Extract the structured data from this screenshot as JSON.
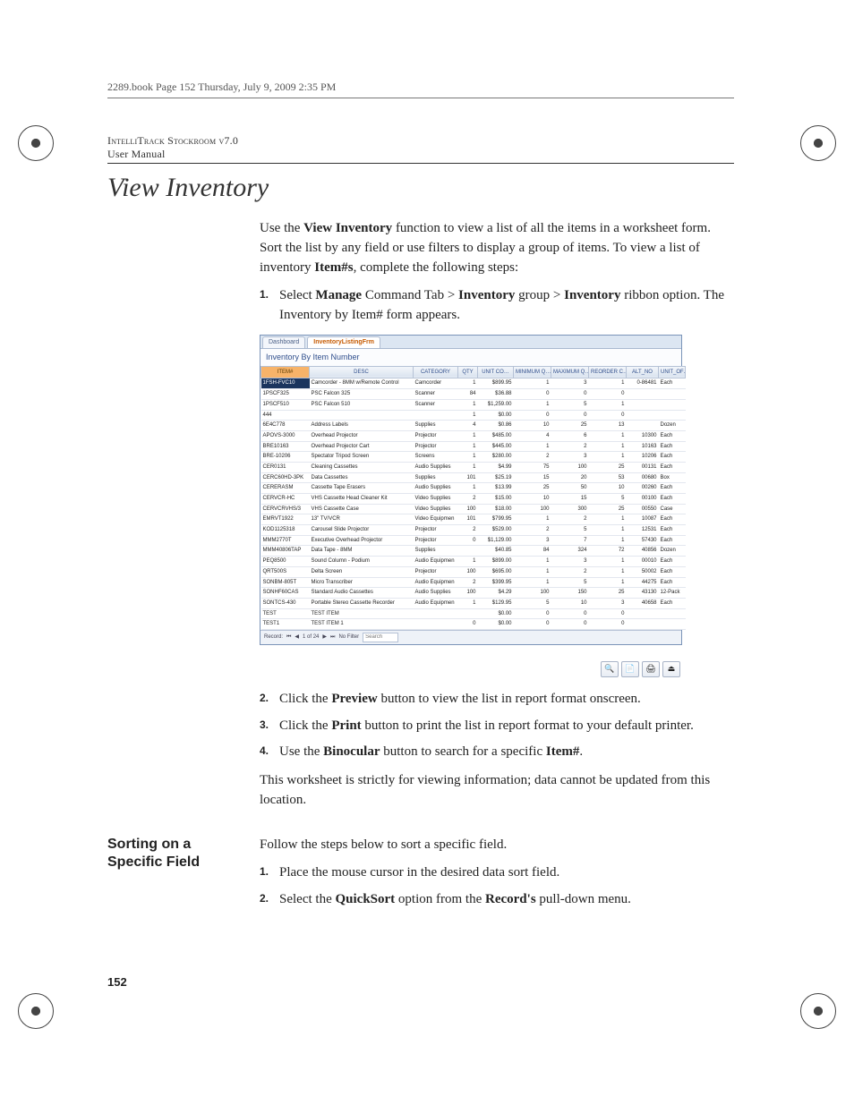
{
  "crop_header": "2289.book  Page 152  Thursday, July 9, 2009  2:35 PM",
  "running_head_line1": "IntelliTrack Stockroom v7.0",
  "running_head_line2": "User Manual",
  "page_title": "View Inventory",
  "intro_pre": "Use the ",
  "intro_b1": "View Inventory",
  "intro_mid": " function to view a list of all the items in a worksheet form. Sort the list by any field or use filters to display a group of items. To view a list of inventory ",
  "intro_b2": "Item#s",
  "intro_post": ", complete the following steps:",
  "step1_pre": "Select ",
  "step1_b1": "Manage",
  "step1_mid1": " Command Tab > ",
  "step1_b2": "Inventory",
  "step1_mid2": " group > ",
  "step1_b3": "Inventory",
  "step1_post": " ribbon option. The Inventory by Item# form appears.",
  "step2_pre": "Click the ",
  "step2_b": "Preview",
  "step2_post": " button to view the list in report format onscreen.",
  "step3_pre": "Click the ",
  "step3_b": "Print",
  "step3_post": " button to print the list in report format to your default printer.",
  "step4_pre": "Use the ",
  "step4_b": "Binocular",
  "step4_mid": " button to search for a specific ",
  "step4_b2": "Item#",
  "step4_post": ".",
  "note_text": "This worksheet is strictly for viewing information; data cannot be updated from this location.",
  "section2_head": "Sorting on a Specific Field",
  "section2_intro": "Follow the steps below to sort a specific field.",
  "s2_step1": "Place the mouse cursor in the desired data sort field.",
  "s2_step2_pre": "Select the ",
  "s2_step2_b1": "QuickSort",
  "s2_step2_mid": " option from the ",
  "s2_step2_b2": "Record's",
  "s2_step2_post": " pull-down menu.",
  "page_number": "152",
  "screenshot": {
    "tab1": "Dashboard",
    "tab2": "InventoryListingFrm",
    "window_title": "Inventory By Item Number",
    "columns": [
      "ITEM#",
      "DESC",
      "CATEGORY",
      "QTY",
      "UNIT CO…",
      "MINIMUM Q…",
      "MAXIMUM Q…",
      "REORDER C…",
      "ALT_NO",
      "UNIT_OF…"
    ],
    "rows": [
      [
        "1FSH-FVC10",
        "Camcorder - 8MM w/Remote Control",
        "Camcorder",
        "1",
        "$899.95",
        "1",
        "3",
        "1",
        "0-86481",
        "Each"
      ],
      [
        "1PSCF325",
        "PSC Falcon 325",
        "Scanner",
        "84",
        "$36.88",
        "0",
        "0",
        "0",
        "",
        ""
      ],
      [
        "1PSCF510",
        "PSC Falcon 510",
        "Scanner",
        "1",
        "$1,259.00",
        "1",
        "5",
        "1",
        "",
        ""
      ],
      [
        "444",
        "",
        "",
        "1",
        "$0.00",
        "0",
        "0",
        "0",
        "",
        ""
      ],
      [
        "6E4C778",
        "Address Labels",
        "Supplies",
        "4",
        "$0.86",
        "10",
        "25",
        "13",
        "",
        "Dozen"
      ],
      [
        "APOVS-3000",
        "Overhead Projector",
        "Projector",
        "1",
        "$485.00",
        "4",
        "6",
        "1",
        "10300",
        "Each"
      ],
      [
        "BRE10163",
        "Overhead Projector Cart",
        "Projector",
        "1",
        "$445.00",
        "1",
        "2",
        "1",
        "10163",
        "Each"
      ],
      [
        "BRE-10206",
        "Spectator Tripod Screen",
        "Screens",
        "1",
        "$280.00",
        "2",
        "3",
        "1",
        "10206",
        "Each"
      ],
      [
        "CER0131",
        "Cleaning Cassettes",
        "Audio Supplies",
        "1",
        "$4.99",
        "75",
        "100",
        "25",
        "00131",
        "Each"
      ],
      [
        "CERC60HD-3PK",
        "Data Cassettes",
        "Supplies",
        "101",
        "$25.19",
        "15",
        "20",
        "53",
        "00680",
        "Box"
      ],
      [
        "CERERASM",
        "Cassette Tape Erasers",
        "Audio Supplies",
        "1",
        "$13.99",
        "25",
        "50",
        "10",
        "00260",
        "Each"
      ],
      [
        "CERVCR-HC",
        "VHS Cassette Head Cleaner Kit",
        "Video Supplies",
        "2",
        "$15.00",
        "10",
        "15",
        "5",
        "00100",
        "Each"
      ],
      [
        "CERVCRVHS/3",
        "VHS Cassette Case",
        "Video Supplies",
        "100",
        "$18.00",
        "100",
        "300",
        "25",
        "00550",
        "Case"
      ],
      [
        "EMRVT1922",
        "13\" TV/VCR",
        "Video Equipmen",
        "101",
        "$799.95",
        "1",
        "2",
        "1",
        "10087",
        "Each"
      ],
      [
        "KOD1125318",
        "Carousel Slide Projector",
        "Projector",
        "2",
        "$529.00",
        "2",
        "5",
        "1",
        "12531",
        "Each"
      ],
      [
        "MMM2770T",
        "Executive Overhead Projector",
        "Projector",
        "0",
        "$1,129.00",
        "3",
        "7",
        "1",
        "57430",
        "Each"
      ],
      [
        "MMM40806TAP",
        "Data Tape - 8MM",
        "Supplies",
        "",
        "$40.85",
        "84",
        "324",
        "72",
        "40856",
        "Dozen"
      ],
      [
        "PEQ8500",
        "Sound Column - Podium",
        "Audio Equipmen",
        "1",
        "$899.00",
        "1",
        "3",
        "1",
        "00010",
        "Each"
      ],
      [
        "QRT500S",
        "Delta Screen",
        "Projector",
        "100",
        "$695.00",
        "1",
        "2",
        "1",
        "50002",
        "Each"
      ],
      [
        "SONBM-805T",
        "Micro Transcriber",
        "Audio Equipmen",
        "2",
        "$399.95",
        "1",
        "5",
        "1",
        "44275",
        "Each"
      ],
      [
        "SONHF60CAS",
        "Standard Audio Cassettes",
        "Audio Supplies",
        "100",
        "$4.29",
        "100",
        "150",
        "25",
        "43130",
        "12-Pack"
      ],
      [
        "SONTCS-430",
        "Portable Stereo Cassette Recorder",
        "Audio Equipmen",
        "1",
        "$129.95",
        "5",
        "10",
        "3",
        "40658",
        "Each"
      ],
      [
        "TEST",
        "TEST ITEM",
        "",
        "",
        "$0.00",
        "0",
        "0",
        "0",
        "",
        ""
      ],
      [
        "TEST1",
        "TEST ITEM 1",
        "",
        "0",
        "$0.00",
        "0",
        "0",
        "0",
        "",
        ""
      ]
    ],
    "record_label": "Record:",
    "record_pos": "1 of 24",
    "no_filter": "No Filter",
    "search_label": "Search",
    "toolbar_icons": [
      "binocular",
      "preview",
      "print",
      "close"
    ]
  }
}
